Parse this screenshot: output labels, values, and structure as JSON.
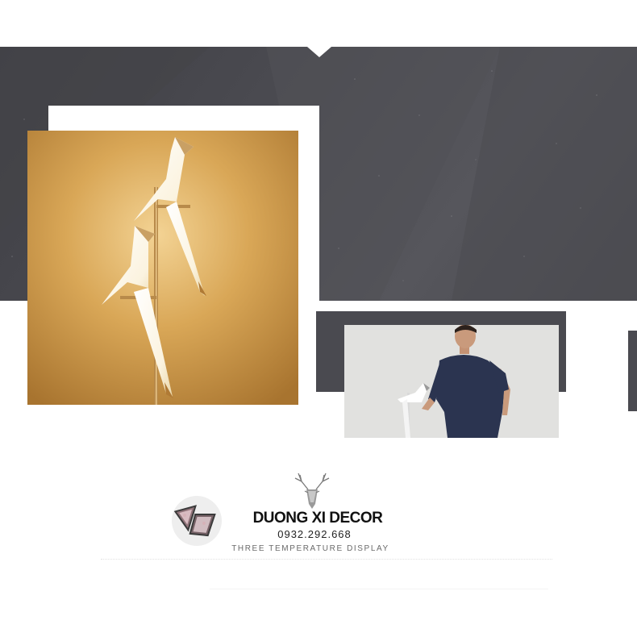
{
  "brand": {
    "name": "DUONG XI DECOR",
    "phone": "0932.292.668",
    "tagline": "THREE TEMPERATURE DISPLAY"
  },
  "images": {
    "main": "bird-lamp-photo",
    "secondary": "man-holding-bird-lamp-photo",
    "logo": "logo-badge-icon",
    "deer": "deer-head-icon"
  },
  "colors": {
    "band": "#4b4b51",
    "lamp_wall": "#c8953f",
    "accent_gold": "#b07a35"
  }
}
